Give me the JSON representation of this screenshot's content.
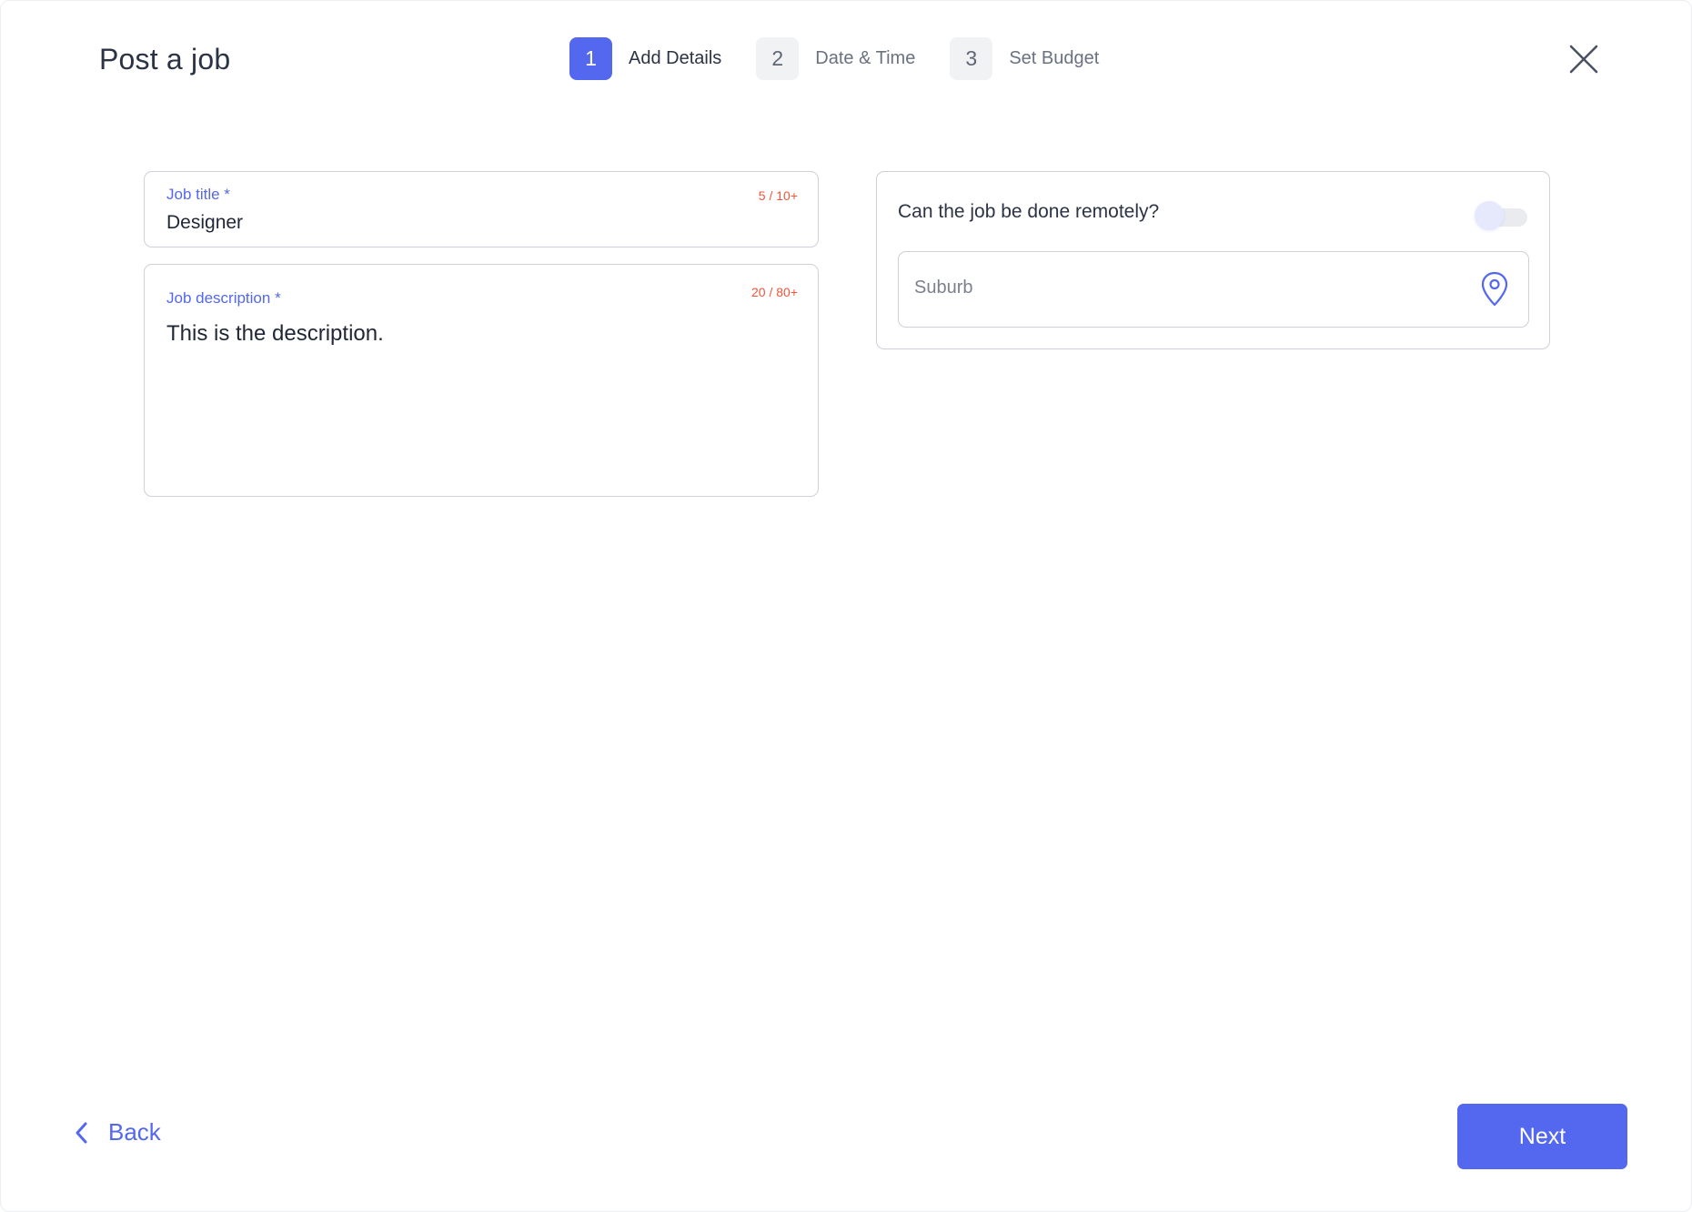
{
  "header": {
    "title": "Post a job",
    "close_icon": "close-icon"
  },
  "stepper": {
    "active_color": "#5468ef",
    "steps": [
      {
        "number": "1",
        "label": "Add Details",
        "active": true
      },
      {
        "number": "2",
        "label": "Date & Time",
        "active": false
      },
      {
        "number": "3",
        "label": "Set Budget",
        "active": false
      }
    ]
  },
  "job_title": {
    "label": "Job title *",
    "counter": "5 / 10+",
    "value": "Designer"
  },
  "job_description": {
    "label": "Job description  *",
    "counter": "20 / 80+",
    "value": "This is the description."
  },
  "remote": {
    "question": "Can the job be done remotely?",
    "toggle_on": false,
    "suburb_placeholder": "Suburb",
    "suburb_value": "",
    "location_icon": "map-pin-icon"
  },
  "footer": {
    "back_label": "Back",
    "back_icon": "chevron-left-icon",
    "next_label": "Next"
  },
  "colors": {
    "accent": "#5468ef",
    "counter": "#f0553a",
    "text": "#2b3345",
    "border": "#cdd0d6"
  }
}
